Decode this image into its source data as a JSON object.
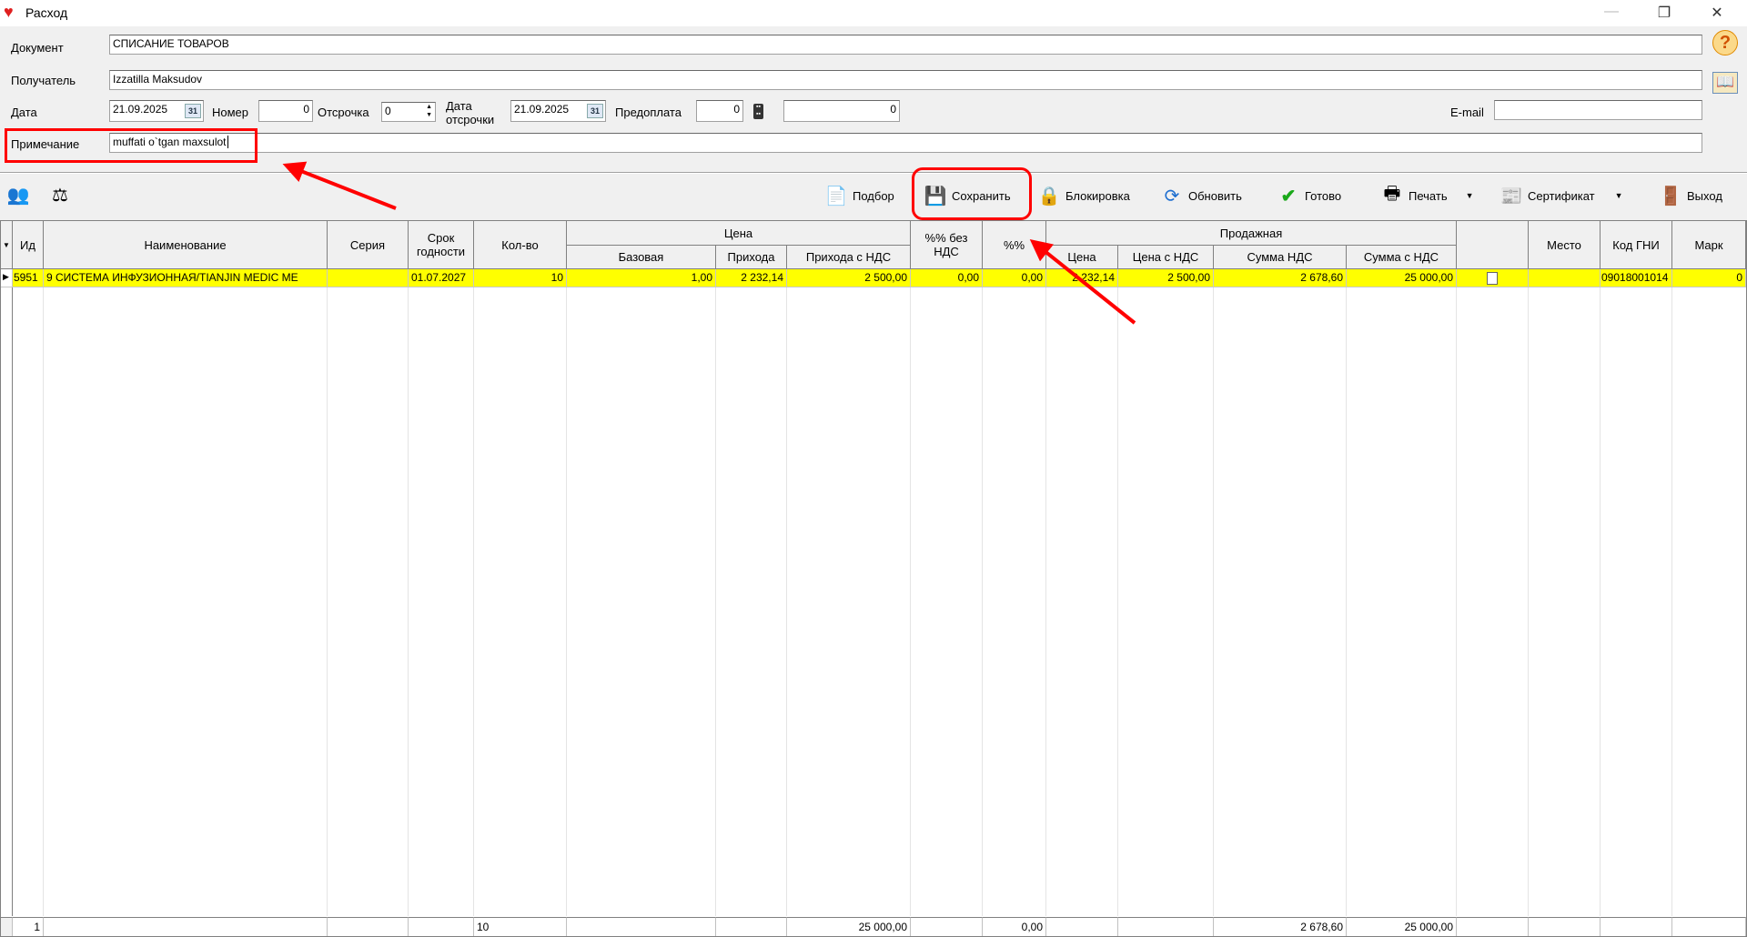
{
  "window": {
    "title": "Расход",
    "controls": [
      "minimize",
      "restore",
      "close"
    ]
  },
  "form": {
    "document_label": "Документ",
    "document_value": "СПИСАНИЕ ТОВАРОВ",
    "recipient_label": "Получатель",
    "recipient_value": "Izzatilla Maksudov",
    "date_label": "Дата",
    "date_value": "21.09.2025",
    "number_label": "Номер",
    "number_value": "0",
    "deferral_label": "Отсрочка",
    "deferral_value": "0",
    "deferral_date_label_1": "Дата",
    "deferral_date_label_2": "отсрочки",
    "deferral_date_value": "21.09.2025",
    "prepay_label": "Предоплата",
    "prepay_value": "0",
    "amount_value": "0",
    "email_label": "E-mail",
    "email_value": "",
    "note_label": "Примечание",
    "note_value": "muffati o`tgan maxsulot",
    "calendar_icon_text": "31"
  },
  "toolbar": {
    "pick": "Подбор",
    "save": "Сохранить",
    "lock": "Блокировка",
    "refresh": "Обновить",
    "done": "Готово",
    "print": "Печать",
    "certificate": "Сертификат",
    "exit": "Выход"
  },
  "grid": {
    "headers": {
      "id": "Ид",
      "name": "Наименование",
      "series": "Серия",
      "expiry_1": "Срок",
      "expiry_2": "годности",
      "qty": "Кол-во",
      "price_group": "Цена",
      "base": "Базовая",
      "incoming": "Прихода",
      "incoming_vat": "Прихода с НДС",
      "pct_novat_1": "%% без",
      "pct_novat_2": "НДС",
      "pct": "%%",
      "sale_group": "Продажная",
      "sale_price": "Цена",
      "sale_price_vat": "Цена с НДС",
      "vat_sum": "Сумма НДС",
      "sum_vat": "Сумма с НДС",
      "check": "",
      "place": "Место",
      "gni_code": "Код ГНИ",
      "mark": "Марк"
    },
    "rows": [
      {
        "id": "5951",
        "name": "9 СИСТЕМА ИНФУЗИОННАЯ/TIANJIN MEDIC ME",
        "series": "",
        "expiry": "01.07.2027",
        "qty": "10",
        "base": "1,00",
        "incoming": "2 232,14",
        "incoming_vat": "2 500,00",
        "pct_novat": "0,00",
        "pct": "0,00",
        "sale_price": "2 232,14",
        "sale_price_vat": "2 500,00",
        "vat_sum": "2 678,60",
        "sum_vat": "25 000,00",
        "checked": false,
        "place": "",
        "gni_code": "09018001014",
        "mark": "0"
      }
    ],
    "footer": {
      "count": "1",
      "qty": "10",
      "incoming_vat": "25 000,00",
      "pct": "0,00",
      "vat_sum": "2 678,60",
      "sum_vat": "25 000,00"
    }
  },
  "colors": {
    "selected_row": "#ffff00",
    "annotation": "#ff0000"
  }
}
